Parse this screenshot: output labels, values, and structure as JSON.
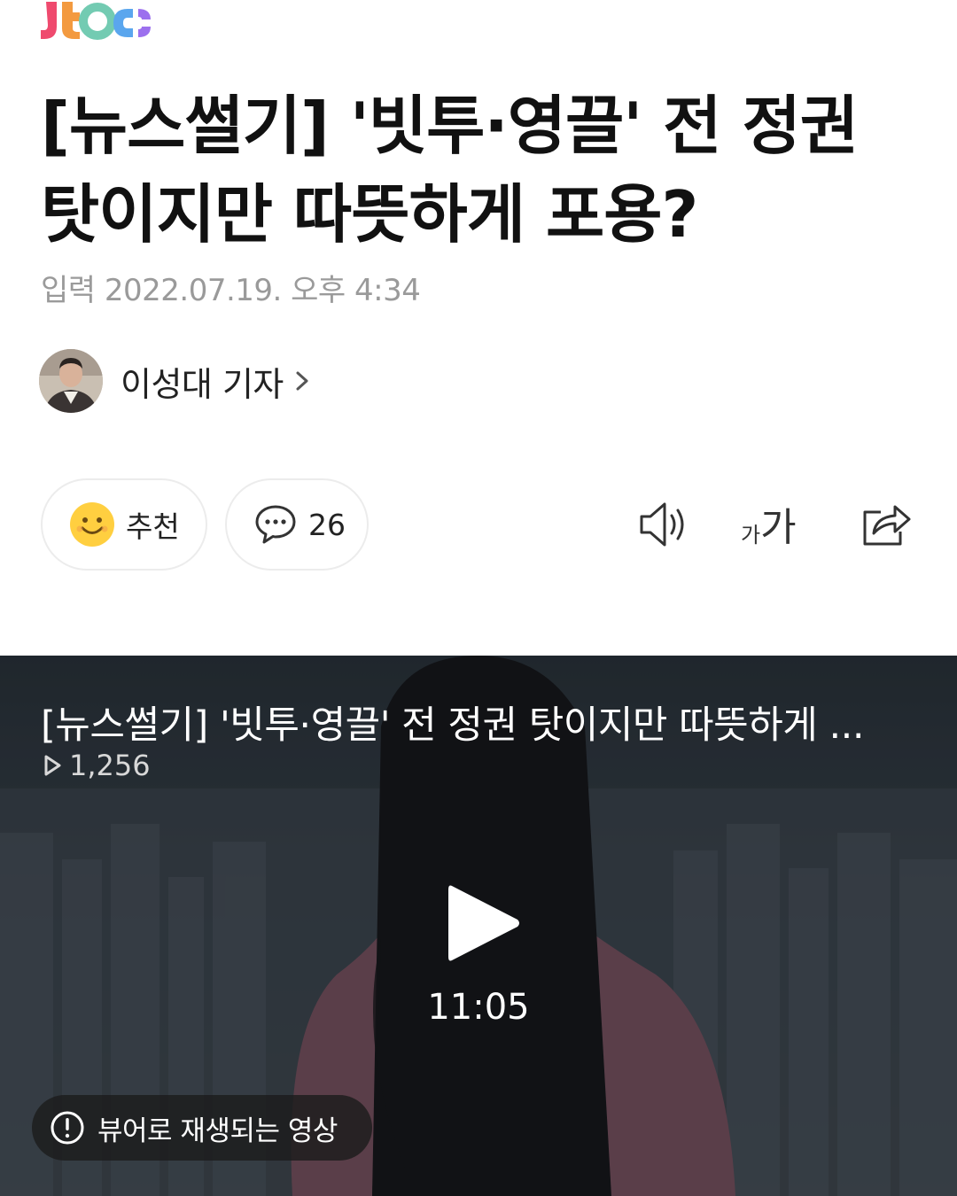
{
  "brand": {
    "logo_text": "JTBC"
  },
  "article": {
    "headline_line1": "[뉴스썰기] '빗투·영끌' 전 정권",
    "headline_line2": "탓이지만 따뜻하게 포용?",
    "date": "입력 2022.07.19. 오후 4:34",
    "reporter": "이성대 기자"
  },
  "actions": {
    "recommend_label": "추천",
    "comment_count": "26",
    "icons": [
      "smiley-icon",
      "comment-bubble-icon",
      "speaker-icon",
      "font-size-icon",
      "share-icon"
    ],
    "font_size_small": "가",
    "font_size_large": "가"
  },
  "video": {
    "title": "[뉴스썰기] '빗투·영끌' 전 정권 탓이지만 따뜻하게 ...",
    "view_count": "1,256",
    "duration": "11:05",
    "viewer_notice": "뷰어로 재생되는 영상"
  },
  "colors": {
    "headline": "#111111",
    "date": "#9a9a9a",
    "pill_border": "#ececec",
    "smiley": "#ffcf40",
    "icon_stroke": "#333333",
    "video_bg": "#303a44"
  }
}
